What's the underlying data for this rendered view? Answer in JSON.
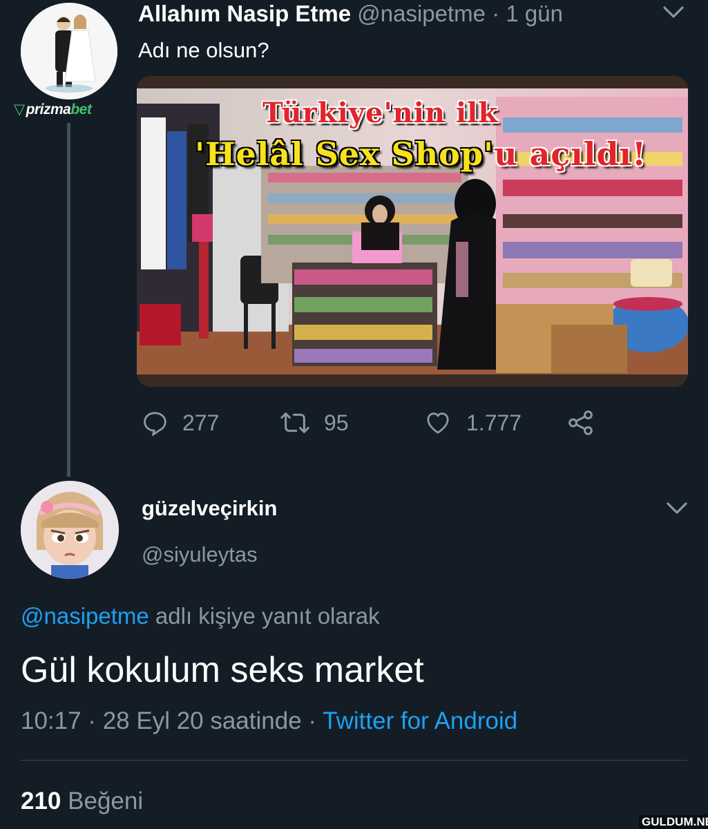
{
  "tweet": {
    "author_name": "Allahım Nasip Etme",
    "author_handle": "@nasipetme",
    "time": "· 1 gün",
    "text": "Adı ne olsun?",
    "media": {
      "headline_line1": "Türkiye'nin ilk",
      "headline_line2_a": "'Helâl Sex Shop'",
      "headline_line2_b": "u açıldı!"
    },
    "stats": {
      "replies": "277",
      "retweets": "95",
      "likes": "1.777"
    }
  },
  "watermark_logo": {
    "part1": "prizma",
    "part2": "bet"
  },
  "reply": {
    "author_name": "güzelveçirkin",
    "author_handle": "@siyuleytas",
    "reply_to_mention": "@nasipetme",
    "reply_to_suffix": " adlı kişiye yanıt olarak",
    "text": "Gül kokulum seks market",
    "timestamp": "10:17 · 28 Eyl 20 saatinde · ",
    "source": "Twitter for Android",
    "likes_count": "210",
    "likes_label": " Beğeni"
  },
  "site_watermark": "GULDUM.NET",
  "colors": {
    "background": "#141d26",
    "secondary_text": "#8899a6",
    "link": "#1da1f2",
    "brand_green": "#3fc26b"
  },
  "icons": [
    "reply-icon",
    "retweet-icon",
    "like-icon",
    "share-icon",
    "chevron-down-icon"
  ]
}
